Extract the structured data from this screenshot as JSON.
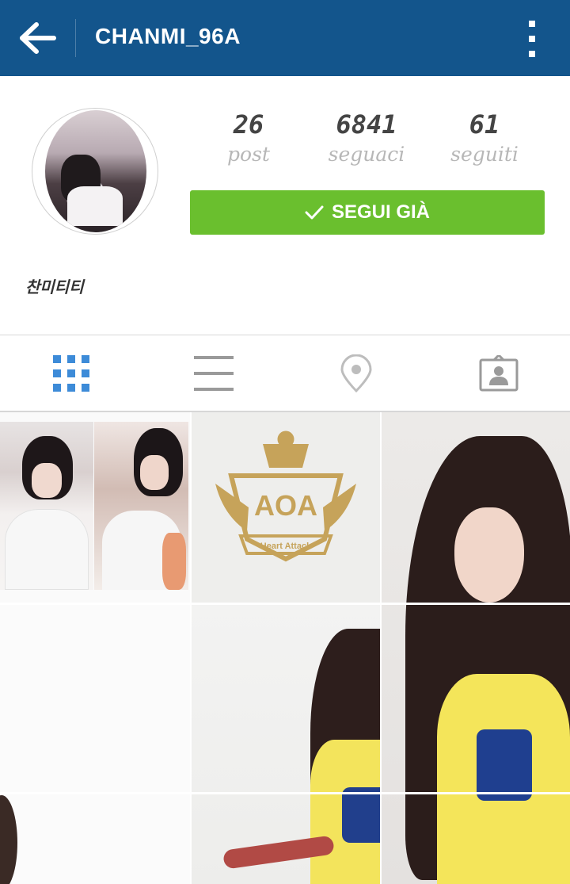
{
  "header": {
    "username": "CHANMI_96A",
    "back_icon": "arrow-left-icon",
    "menu_icon": "more-vert-icon",
    "background": "#13558c"
  },
  "profile": {
    "stats": [
      {
        "value": "26",
        "label": "post"
      },
      {
        "value": "6841",
        "label": "seguaci"
      },
      {
        "value": "61",
        "label": "seguiti"
      }
    ],
    "follow_button": {
      "label": "SEGUI GIÀ",
      "color": "#6abf2e"
    },
    "bio": "찬미티티"
  },
  "tabs": [
    {
      "name": "grid",
      "icon": "grid-icon",
      "active": true
    },
    {
      "name": "list",
      "icon": "list-icon",
      "active": false
    },
    {
      "name": "places",
      "icon": "location-pin-icon",
      "active": false
    },
    {
      "name": "tagged",
      "icon": "tagged-person-icon",
      "active": false
    }
  ],
  "logo_text": "AOA",
  "logo_sub": "Heart Attack",
  "accent": "#3d8bd8"
}
